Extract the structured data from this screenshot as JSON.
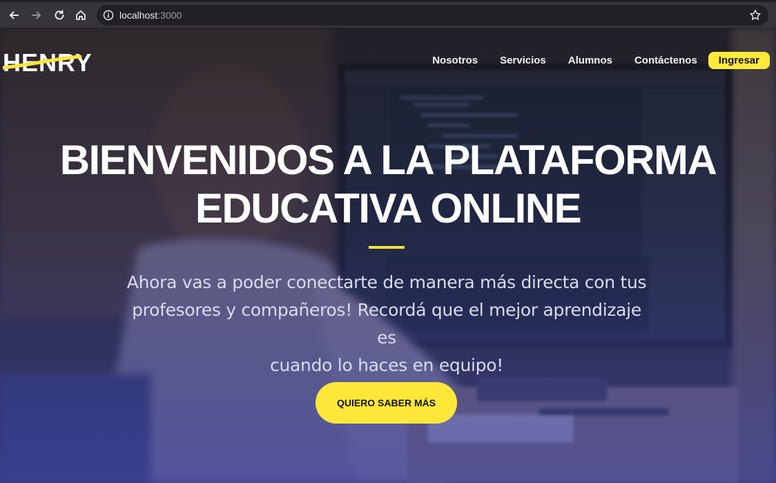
{
  "browser": {
    "url_host": "localhost",
    "url_port": ":3000",
    "icons": [
      "back-arrow-icon",
      "forward-arrow-icon",
      "reload-icon",
      "home-icon",
      "info-icon",
      "star-icon"
    ]
  },
  "navbar": {
    "logo_text": "HENRY",
    "links": [
      "Nosotros",
      "Servicios",
      "Alumnos",
      "Contáctenos"
    ],
    "login_label": "Ingresar"
  },
  "hero": {
    "headline_line1": "BIENVENIDOS A LA PLATAFORMA",
    "headline_line2": "EDUCATIVA ONLINE",
    "subtitle_line1": "Ahora vas a poder conectarte de manera más directa con tus",
    "subtitle_line2": "profesores y compañeros! Recordá que el mejor aprendizaje es",
    "subtitle_line3": "cuando lo haces en equipo!",
    "cta_label": "QUIERO SABER MÁS"
  },
  "colors": {
    "accent_yellow": "#ffe73a",
    "overlay_blue": "#3e42a0",
    "chrome_dark": "#35363a"
  }
}
